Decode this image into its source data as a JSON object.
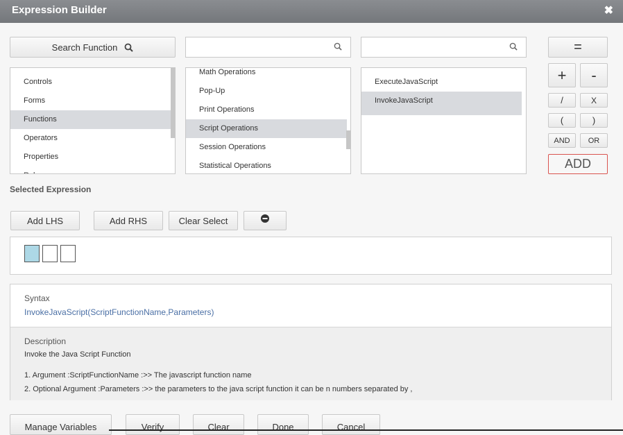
{
  "window": {
    "title": "Expression Builder"
  },
  "search": {
    "function_label": "Search Function"
  },
  "category_list": {
    "items": [
      "Controls",
      "Forms",
      "Functions",
      "Operators",
      "Properties",
      "Rules"
    ],
    "selected_index": 2
  },
  "operation_list": {
    "items": [
      "Math Operations",
      "Pop-Up",
      "Print Operations",
      "Script Operations",
      "Session Operations",
      "Statistical Operations"
    ],
    "selected_index": 3
  },
  "function_list": {
    "items": [
      "ExecuteJavaScript",
      "InvokeJavaScript"
    ],
    "selected_index": 1
  },
  "operators": {
    "equals": "=",
    "plus": "+",
    "minus": "-",
    "divide": "/",
    "multiply": "X",
    "open_paren": "(",
    "close_paren": ")",
    "and": "AND",
    "or": "OR",
    "add": "ADD"
  },
  "expression": {
    "label": "Selected Expression",
    "add_lhs": "Add LHS",
    "add_rhs": "Add RHS",
    "clear_select": "Clear Select"
  },
  "syntax": {
    "label": "Syntax",
    "value": "InvokeJavaScript(ScriptFunctionName,Parameters)"
  },
  "description": {
    "label": "Description",
    "text": "Invoke the Java Script Function",
    "arg1": "1. Argument :ScriptFunctionName :>> The javascript function name",
    "arg2": "2. Optional Argument :Parameters :>> the parameters to the java script function it can be n numbers separated by ,"
  },
  "footer": {
    "manage_variables": "Manage Variables",
    "verify": "Verify",
    "clear": "Clear",
    "done": "Done",
    "cancel": "Cancel"
  },
  "colors": {
    "titlebar": "#7d8084",
    "selected_row": "#d8dade",
    "syntax_value": "#4a6fa5",
    "active_slot": "#add8e6",
    "add_border": "#d9534f"
  }
}
